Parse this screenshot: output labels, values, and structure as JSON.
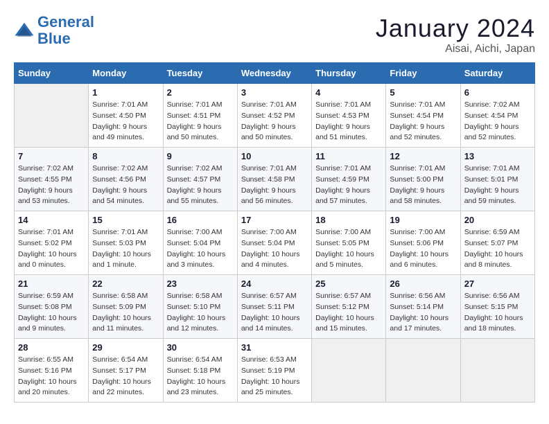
{
  "logo": {
    "line1": "General",
    "line2": "Blue"
  },
  "title": "January 2024",
  "subtitle": "Aisai, Aichi, Japan",
  "weekdays": [
    "Sunday",
    "Monday",
    "Tuesday",
    "Wednesday",
    "Thursday",
    "Friday",
    "Saturday"
  ],
  "weeks": [
    [
      {
        "day": "",
        "info": ""
      },
      {
        "day": "1",
        "info": "Sunrise: 7:01 AM\nSunset: 4:50 PM\nDaylight: 9 hours\nand 49 minutes."
      },
      {
        "day": "2",
        "info": "Sunrise: 7:01 AM\nSunset: 4:51 PM\nDaylight: 9 hours\nand 50 minutes."
      },
      {
        "day": "3",
        "info": "Sunrise: 7:01 AM\nSunset: 4:52 PM\nDaylight: 9 hours\nand 50 minutes."
      },
      {
        "day": "4",
        "info": "Sunrise: 7:01 AM\nSunset: 4:53 PM\nDaylight: 9 hours\nand 51 minutes."
      },
      {
        "day": "5",
        "info": "Sunrise: 7:01 AM\nSunset: 4:54 PM\nDaylight: 9 hours\nand 52 minutes."
      },
      {
        "day": "6",
        "info": "Sunrise: 7:02 AM\nSunset: 4:54 PM\nDaylight: 9 hours\nand 52 minutes."
      }
    ],
    [
      {
        "day": "7",
        "info": "Sunrise: 7:02 AM\nSunset: 4:55 PM\nDaylight: 9 hours\nand 53 minutes."
      },
      {
        "day": "8",
        "info": "Sunrise: 7:02 AM\nSunset: 4:56 PM\nDaylight: 9 hours\nand 54 minutes."
      },
      {
        "day": "9",
        "info": "Sunrise: 7:02 AM\nSunset: 4:57 PM\nDaylight: 9 hours\nand 55 minutes."
      },
      {
        "day": "10",
        "info": "Sunrise: 7:01 AM\nSunset: 4:58 PM\nDaylight: 9 hours\nand 56 minutes."
      },
      {
        "day": "11",
        "info": "Sunrise: 7:01 AM\nSunset: 4:59 PM\nDaylight: 9 hours\nand 57 minutes."
      },
      {
        "day": "12",
        "info": "Sunrise: 7:01 AM\nSunset: 5:00 PM\nDaylight: 9 hours\nand 58 minutes."
      },
      {
        "day": "13",
        "info": "Sunrise: 7:01 AM\nSunset: 5:01 PM\nDaylight: 9 hours\nand 59 minutes."
      }
    ],
    [
      {
        "day": "14",
        "info": "Sunrise: 7:01 AM\nSunset: 5:02 PM\nDaylight: 10 hours\nand 0 minutes."
      },
      {
        "day": "15",
        "info": "Sunrise: 7:01 AM\nSunset: 5:03 PM\nDaylight: 10 hours\nand 1 minute."
      },
      {
        "day": "16",
        "info": "Sunrise: 7:00 AM\nSunset: 5:04 PM\nDaylight: 10 hours\nand 3 minutes."
      },
      {
        "day": "17",
        "info": "Sunrise: 7:00 AM\nSunset: 5:04 PM\nDaylight: 10 hours\nand 4 minutes."
      },
      {
        "day": "18",
        "info": "Sunrise: 7:00 AM\nSunset: 5:05 PM\nDaylight: 10 hours\nand 5 minutes."
      },
      {
        "day": "19",
        "info": "Sunrise: 7:00 AM\nSunset: 5:06 PM\nDaylight: 10 hours\nand 6 minutes."
      },
      {
        "day": "20",
        "info": "Sunrise: 6:59 AM\nSunset: 5:07 PM\nDaylight: 10 hours\nand 8 minutes."
      }
    ],
    [
      {
        "day": "21",
        "info": "Sunrise: 6:59 AM\nSunset: 5:08 PM\nDaylight: 10 hours\nand 9 minutes."
      },
      {
        "day": "22",
        "info": "Sunrise: 6:58 AM\nSunset: 5:09 PM\nDaylight: 10 hours\nand 11 minutes."
      },
      {
        "day": "23",
        "info": "Sunrise: 6:58 AM\nSunset: 5:10 PM\nDaylight: 10 hours\nand 12 minutes."
      },
      {
        "day": "24",
        "info": "Sunrise: 6:57 AM\nSunset: 5:11 PM\nDaylight: 10 hours\nand 14 minutes."
      },
      {
        "day": "25",
        "info": "Sunrise: 6:57 AM\nSunset: 5:12 PM\nDaylight: 10 hours\nand 15 minutes."
      },
      {
        "day": "26",
        "info": "Sunrise: 6:56 AM\nSunset: 5:14 PM\nDaylight: 10 hours\nand 17 minutes."
      },
      {
        "day": "27",
        "info": "Sunrise: 6:56 AM\nSunset: 5:15 PM\nDaylight: 10 hours\nand 18 minutes."
      }
    ],
    [
      {
        "day": "28",
        "info": "Sunrise: 6:55 AM\nSunset: 5:16 PM\nDaylight: 10 hours\nand 20 minutes."
      },
      {
        "day": "29",
        "info": "Sunrise: 6:54 AM\nSunset: 5:17 PM\nDaylight: 10 hours\nand 22 minutes."
      },
      {
        "day": "30",
        "info": "Sunrise: 6:54 AM\nSunset: 5:18 PM\nDaylight: 10 hours\nand 23 minutes."
      },
      {
        "day": "31",
        "info": "Sunrise: 6:53 AM\nSunset: 5:19 PM\nDaylight: 10 hours\nand 25 minutes."
      },
      {
        "day": "",
        "info": ""
      },
      {
        "day": "",
        "info": ""
      },
      {
        "day": "",
        "info": ""
      }
    ]
  ]
}
